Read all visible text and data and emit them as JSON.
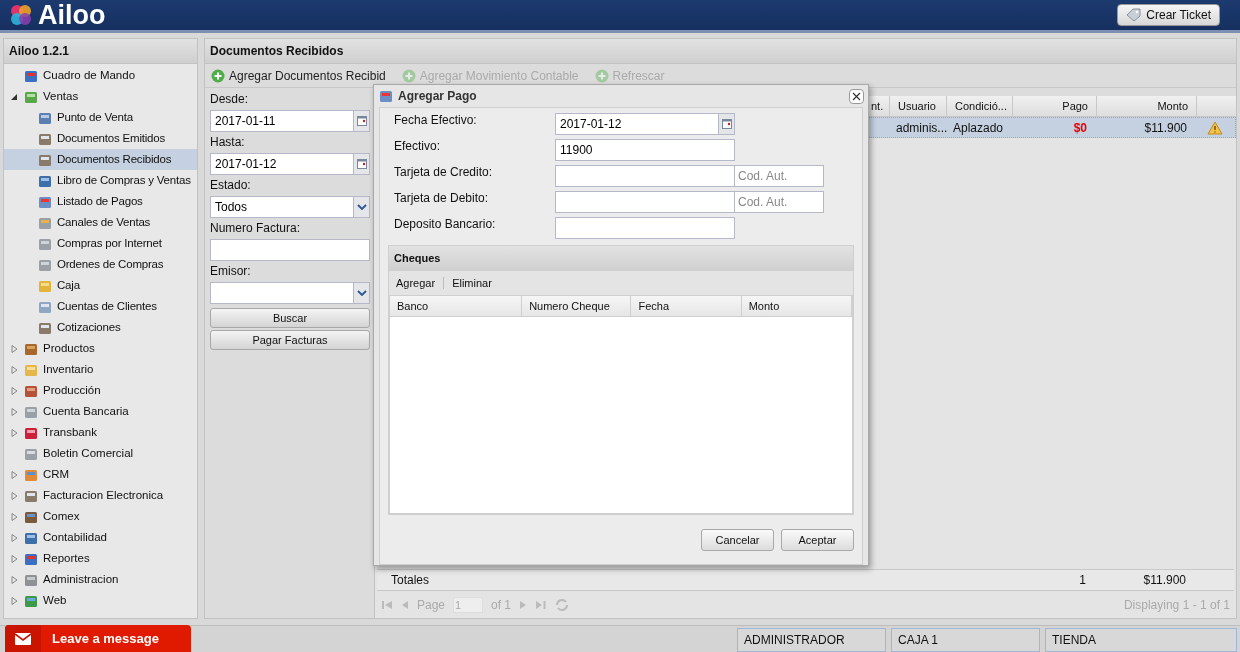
{
  "header": {
    "logo": "Ailoo",
    "button": "Crear Ticket"
  },
  "sidebar": {
    "title": "Ailoo 1.2.1",
    "items": [
      {
        "label": "Cuadro de Mando",
        "kind": "leaf",
        "selected": false
      },
      {
        "label": "Ventas",
        "kind": "folder",
        "expanded": true,
        "selected": false,
        "children": [
          {
            "label": "Punto de Venta",
            "selected": false
          },
          {
            "label": "Documentos Emitidos",
            "selected": false
          },
          {
            "label": "Documentos Recibidos",
            "selected": true
          },
          {
            "label": "Libro de Compras y Ventas",
            "selected": false
          },
          {
            "label": "Listado de Pagos",
            "selected": false
          },
          {
            "label": "Canales de Ventas",
            "selected": false
          },
          {
            "label": "Compras por Internet",
            "selected": false
          },
          {
            "label": "Ordenes de Compras",
            "selected": false
          },
          {
            "label": "Caja",
            "selected": false
          },
          {
            "label": "Cuentas de Clientes",
            "selected": false
          },
          {
            "label": "Cotizaciones",
            "selected": false
          }
        ]
      },
      {
        "label": "Productos",
        "kind": "folder",
        "expanded": false,
        "selected": false
      },
      {
        "label": "Inventario",
        "kind": "folder",
        "expanded": false,
        "selected": false
      },
      {
        "label": "Producción",
        "kind": "folder",
        "expanded": false,
        "selected": false
      },
      {
        "label": "Cuenta Bancaria",
        "kind": "folder",
        "expanded": false,
        "selected": false
      },
      {
        "label": "Transbank",
        "kind": "folder",
        "expanded": false,
        "selected": false
      },
      {
        "label": "Boletin Comercial",
        "kind": "leaf",
        "selected": false
      },
      {
        "label": "CRM",
        "kind": "folder",
        "expanded": false,
        "selected": false
      },
      {
        "label": "Facturacion Electronica",
        "kind": "folder",
        "expanded": false,
        "selected": false
      },
      {
        "label": "Comex",
        "kind": "folder",
        "expanded": false,
        "selected": false
      },
      {
        "label": "Contabilidad",
        "kind": "folder",
        "expanded": false,
        "selected": false
      },
      {
        "label": "Reportes",
        "kind": "folder",
        "expanded": false,
        "selected": false
      },
      {
        "label": "Administracion",
        "kind": "folder",
        "expanded": false,
        "selected": false
      },
      {
        "label": "Web",
        "kind": "folder",
        "expanded": false,
        "selected": false
      }
    ]
  },
  "main": {
    "title": "Documentos Recibidos",
    "toolbar": [
      {
        "label": "Agregar Documentos Recibid",
        "disabled": false
      },
      {
        "label": "Agregar Movimiento Contable",
        "disabled": true
      },
      {
        "label": "Refrescar",
        "disabled": true
      }
    ],
    "filters": [
      {
        "label": "Desde:",
        "kind": "date",
        "value": "2017-01-11"
      },
      {
        "label": "Hasta:",
        "kind": "date",
        "value": "2017-01-12"
      },
      {
        "label": "Estado:",
        "kind": "select",
        "value": "Todos"
      },
      {
        "label": "Numero Factura:",
        "kind": "text"
      },
      {
        "label": "Emisor:",
        "kind": "select"
      }
    ],
    "filter_buttons": [
      "Buscar",
      "Pagar Facturas"
    ],
    "grid": {
      "columns": [
        "nt.",
        "Usuario",
        "Condició...",
        "Pago",
        "Monto"
      ],
      "rows": [
        {
          "cells": [
            "",
            "adminis...",
            "Aplazado",
            "$0",
            "$11.900"
          ],
          "selected": true
        }
      ],
      "totals": {
        "label": "Totales",
        "count": "1",
        "amount": "$11.900"
      },
      "pager": {
        "page_label": "Page",
        "page": "1",
        "of": "of 1",
        "displaying": "Displaying 1 - 1 of 1"
      }
    }
  },
  "dialog": {
    "title": "Agregar Pago",
    "fields": [
      {
        "label": "Fecha Efectivo:",
        "kind": "date",
        "value": "2017-01-12"
      },
      {
        "label": "Efectivo:",
        "kind": "text",
        "value": "11900"
      },
      {
        "label": "Tarjeta de Credito:",
        "kind": "card",
        "placeholder": "Cod. Aut."
      },
      {
        "label": "Tarjeta de Debito:",
        "kind": "card",
        "placeholder": "Cod. Aut."
      },
      {
        "label": "Deposito Bancario:",
        "kind": "text"
      }
    ],
    "cheques": {
      "title": "Cheques",
      "actions": [
        "Agregar",
        "Eliminar"
      ],
      "columns": [
        "Banco",
        "Numero Cheque",
        "Fecha",
        "Monto"
      ]
    },
    "buttons": [
      "Cancelar",
      "Aceptar"
    ]
  },
  "status_bar": {
    "message_button": "Leave a message",
    "cells": [
      "ADMINISTRADOR",
      "CAJA 1",
      "TIENDA"
    ]
  }
}
